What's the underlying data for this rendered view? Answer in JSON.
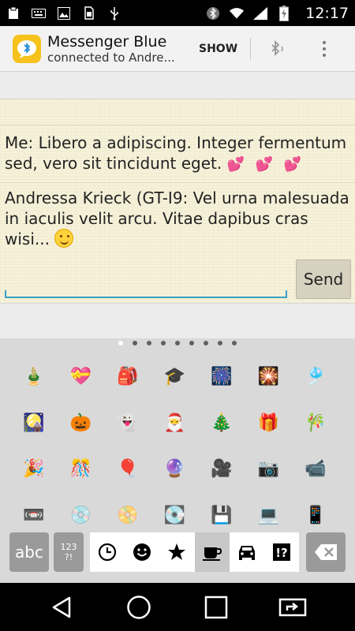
{
  "status_bar": {
    "time": "12:17",
    "left_icons": [
      "clipboard-icon",
      "keyboard-icon",
      "image-icon",
      "sim-icon",
      "usb-icon"
    ],
    "right_icons": [
      "bluetooth-icon",
      "wifi-icon",
      "signal-icon",
      "battery-charging-icon"
    ]
  },
  "action_bar": {
    "title": "Messenger Blue",
    "subtitle": "connected to Andre...",
    "show_label": "SHOW"
  },
  "messages": [
    {
      "text": "Me:  Libero a adipiscing. Integer fermentum sed, vero sit tincidunt eget. ",
      "emoji": "💕 💕 💕"
    },
    {
      "text": "Andressa Krieck (GT-I9:  Vel urna malesuada in iaculis velit arcu. Vitae dapibus cras wisi... ",
      "emoji": "😊"
    }
  ],
  "send_label": "Send",
  "keyboard": {
    "page_count": 9,
    "active_page": 0,
    "emoji_rows": [
      [
        "🎍",
        "💝",
        "🎒",
        "🎓",
        "🎆",
        "🎇",
        "🎐"
      ],
      [
        "🎑",
        "🎃",
        "👻",
        "🎅",
        "🎄",
        "🎁",
        "🎋"
      ],
      [
        "🎉",
        "🎊",
        "🎈",
        "🔮",
        "🎥",
        "📷",
        "📹"
      ],
      [
        "📼",
        "💿",
        "📀",
        "💽",
        "💾",
        "💻",
        "📱"
      ]
    ],
    "abc_label": "abc",
    "sym_label": "123\n?!",
    "categories": [
      "recent-icon",
      "smiley-icon",
      "star-icon",
      "coffee-icon",
      "car-icon",
      "symbols-icon"
    ],
    "active_category": 3
  },
  "nav_bar": [
    "back-icon",
    "home-icon",
    "recents-icon",
    "screen-share-icon"
  ]
}
